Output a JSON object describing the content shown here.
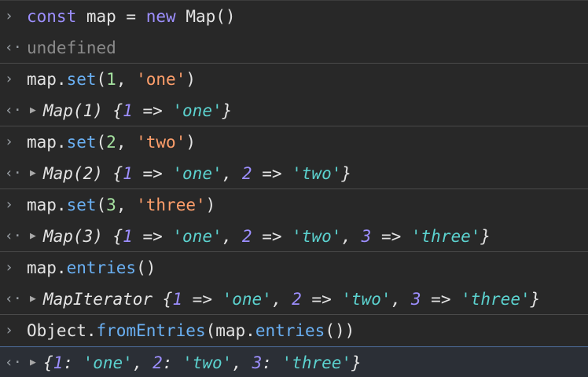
{
  "console": {
    "input_prompt": "›",
    "output_prompt": "‹·",
    "expand_caret": "▶",
    "entries": [
      {
        "input": [
          {
            "t": "const",
            "c": "kw"
          },
          {
            "t": " map = ",
            "c": "pl"
          },
          {
            "t": "new",
            "c": "kw"
          },
          {
            "t": " Map()",
            "c": "pl"
          }
        ],
        "output": [
          {
            "t": "undefined",
            "c": "undef"
          }
        ],
        "output_expandable": false
      },
      {
        "input": [
          {
            "t": "map.",
            "c": "pl"
          },
          {
            "t": "set",
            "c": "fn"
          },
          {
            "t": "(",
            "c": "pl"
          },
          {
            "t": "1",
            "c": "num"
          },
          {
            "t": ", ",
            "c": "pl"
          },
          {
            "t": "'one'",
            "c": "str"
          },
          {
            "t": ")",
            "c": "pl"
          }
        ],
        "output": [
          {
            "t": "Map(1) {",
            "c": "oname"
          },
          {
            "t": "1",
            "c": "onum"
          },
          {
            "t": " => ",
            "c": "oname"
          },
          {
            "t": "'one'",
            "c": "ostr"
          },
          {
            "t": "}",
            "c": "oname"
          }
        ],
        "output_expandable": true
      },
      {
        "input": [
          {
            "t": "map.",
            "c": "pl"
          },
          {
            "t": "set",
            "c": "fn"
          },
          {
            "t": "(",
            "c": "pl"
          },
          {
            "t": "2",
            "c": "num"
          },
          {
            "t": ", ",
            "c": "pl"
          },
          {
            "t": "'two'",
            "c": "str"
          },
          {
            "t": ")",
            "c": "pl"
          }
        ],
        "output": [
          {
            "t": "Map(2) {",
            "c": "oname"
          },
          {
            "t": "1",
            "c": "onum"
          },
          {
            "t": " => ",
            "c": "oname"
          },
          {
            "t": "'one'",
            "c": "ostr"
          },
          {
            "t": ", ",
            "c": "oname"
          },
          {
            "t": "2",
            "c": "onum"
          },
          {
            "t": " => ",
            "c": "oname"
          },
          {
            "t": "'two'",
            "c": "ostr"
          },
          {
            "t": "}",
            "c": "oname"
          }
        ],
        "output_expandable": true
      },
      {
        "input": [
          {
            "t": "map.",
            "c": "pl"
          },
          {
            "t": "set",
            "c": "fn"
          },
          {
            "t": "(",
            "c": "pl"
          },
          {
            "t": "3",
            "c": "num"
          },
          {
            "t": ", ",
            "c": "pl"
          },
          {
            "t": "'three'",
            "c": "str"
          },
          {
            "t": ")",
            "c": "pl"
          }
        ],
        "output": [
          {
            "t": "Map(3) {",
            "c": "oname"
          },
          {
            "t": "1",
            "c": "onum"
          },
          {
            "t": " => ",
            "c": "oname"
          },
          {
            "t": "'one'",
            "c": "ostr"
          },
          {
            "t": ", ",
            "c": "oname"
          },
          {
            "t": "2",
            "c": "onum"
          },
          {
            "t": " => ",
            "c": "oname"
          },
          {
            "t": "'two'",
            "c": "ostr"
          },
          {
            "t": ", ",
            "c": "oname"
          },
          {
            "t": "3",
            "c": "onum"
          },
          {
            "t": " => ",
            "c": "oname"
          },
          {
            "t": "'three'",
            "c": "ostr"
          },
          {
            "t": "}",
            "c": "oname"
          }
        ],
        "output_expandable": true
      },
      {
        "input": [
          {
            "t": "map.",
            "c": "pl"
          },
          {
            "t": "entries",
            "c": "fn"
          },
          {
            "t": "()",
            "c": "pl"
          }
        ],
        "output": [
          {
            "t": "MapIterator {",
            "c": "oname"
          },
          {
            "t": "1",
            "c": "onum"
          },
          {
            "t": " => ",
            "c": "oname"
          },
          {
            "t": "'one'",
            "c": "ostr"
          },
          {
            "t": ", ",
            "c": "oname"
          },
          {
            "t": "2",
            "c": "onum"
          },
          {
            "t": " => ",
            "c": "oname"
          },
          {
            "t": "'two'",
            "c": "ostr"
          },
          {
            "t": ", ",
            "c": "oname"
          },
          {
            "t": "3",
            "c": "onum"
          },
          {
            "t": " => ",
            "c": "oname"
          },
          {
            "t": "'three'",
            "c": "ostr"
          },
          {
            "t": "}",
            "c": "oname"
          }
        ],
        "output_expandable": true
      },
      {
        "input": [
          {
            "t": "Object.",
            "c": "pl"
          },
          {
            "t": "fromEntries",
            "c": "fn"
          },
          {
            "t": "(map.",
            "c": "pl"
          },
          {
            "t": "entries",
            "c": "fn"
          },
          {
            "t": "())",
            "c": "pl"
          }
        ],
        "output": [
          {
            "t": "{",
            "c": "oname"
          },
          {
            "t": "1",
            "c": "onum"
          },
          {
            "t": ": ",
            "c": "oname"
          },
          {
            "t": "'one'",
            "c": "ostr"
          },
          {
            "t": ", ",
            "c": "oname"
          },
          {
            "t": "2",
            "c": "onum"
          },
          {
            "t": ": ",
            "c": "oname"
          },
          {
            "t": "'two'",
            "c": "ostr"
          },
          {
            "t": ", ",
            "c": "oname"
          },
          {
            "t": "3",
            "c": "onum"
          },
          {
            "t": ": ",
            "c": "oname"
          },
          {
            "t": "'three'",
            "c": "ostr"
          },
          {
            "t": "}",
            "c": "oname"
          }
        ],
        "output_expandable": true
      }
    ]
  }
}
